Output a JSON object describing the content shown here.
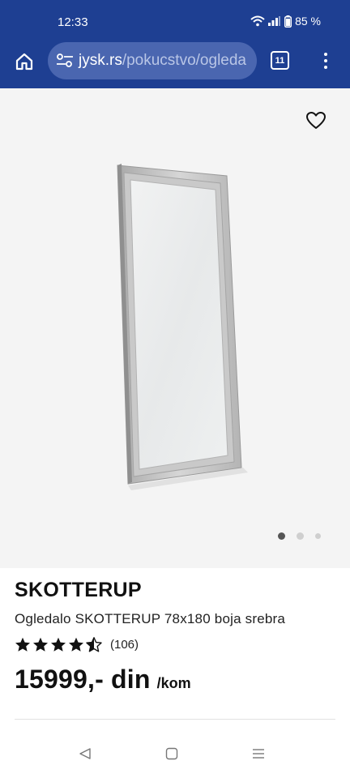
{
  "status_bar": {
    "time": "12:33",
    "battery": "85 %"
  },
  "browser": {
    "url_host": "jysk.rs",
    "url_path": "/pokucstvo/ogleda",
    "tab_count": "11"
  },
  "gallery": {
    "total_images": 3,
    "active_index": 0
  },
  "product": {
    "name": "SKOTTERUP",
    "description": "Ogledalo SKOTTERUP 78x180 boja srebra",
    "rating": 4.5,
    "review_count": "(106)",
    "price": "15999,- din",
    "unit": "/kom"
  },
  "colors": {
    "browser_bar": "#1e3f92",
    "url_field": "#4a66b0",
    "image_background": "#f4f4f4",
    "text": "#111111"
  },
  "icons": {
    "home": "home-icon",
    "site_settings": "tune-icon",
    "tabs": "tabs-icon",
    "menu": "more-vert-icon",
    "favorite": "heart-outline-icon",
    "star_full": "star-filled-icon",
    "star_half": "star-half-icon",
    "nav_back": "triangle-back-icon",
    "nav_home": "square-home-icon",
    "nav_recents": "lines-recents-icon"
  }
}
